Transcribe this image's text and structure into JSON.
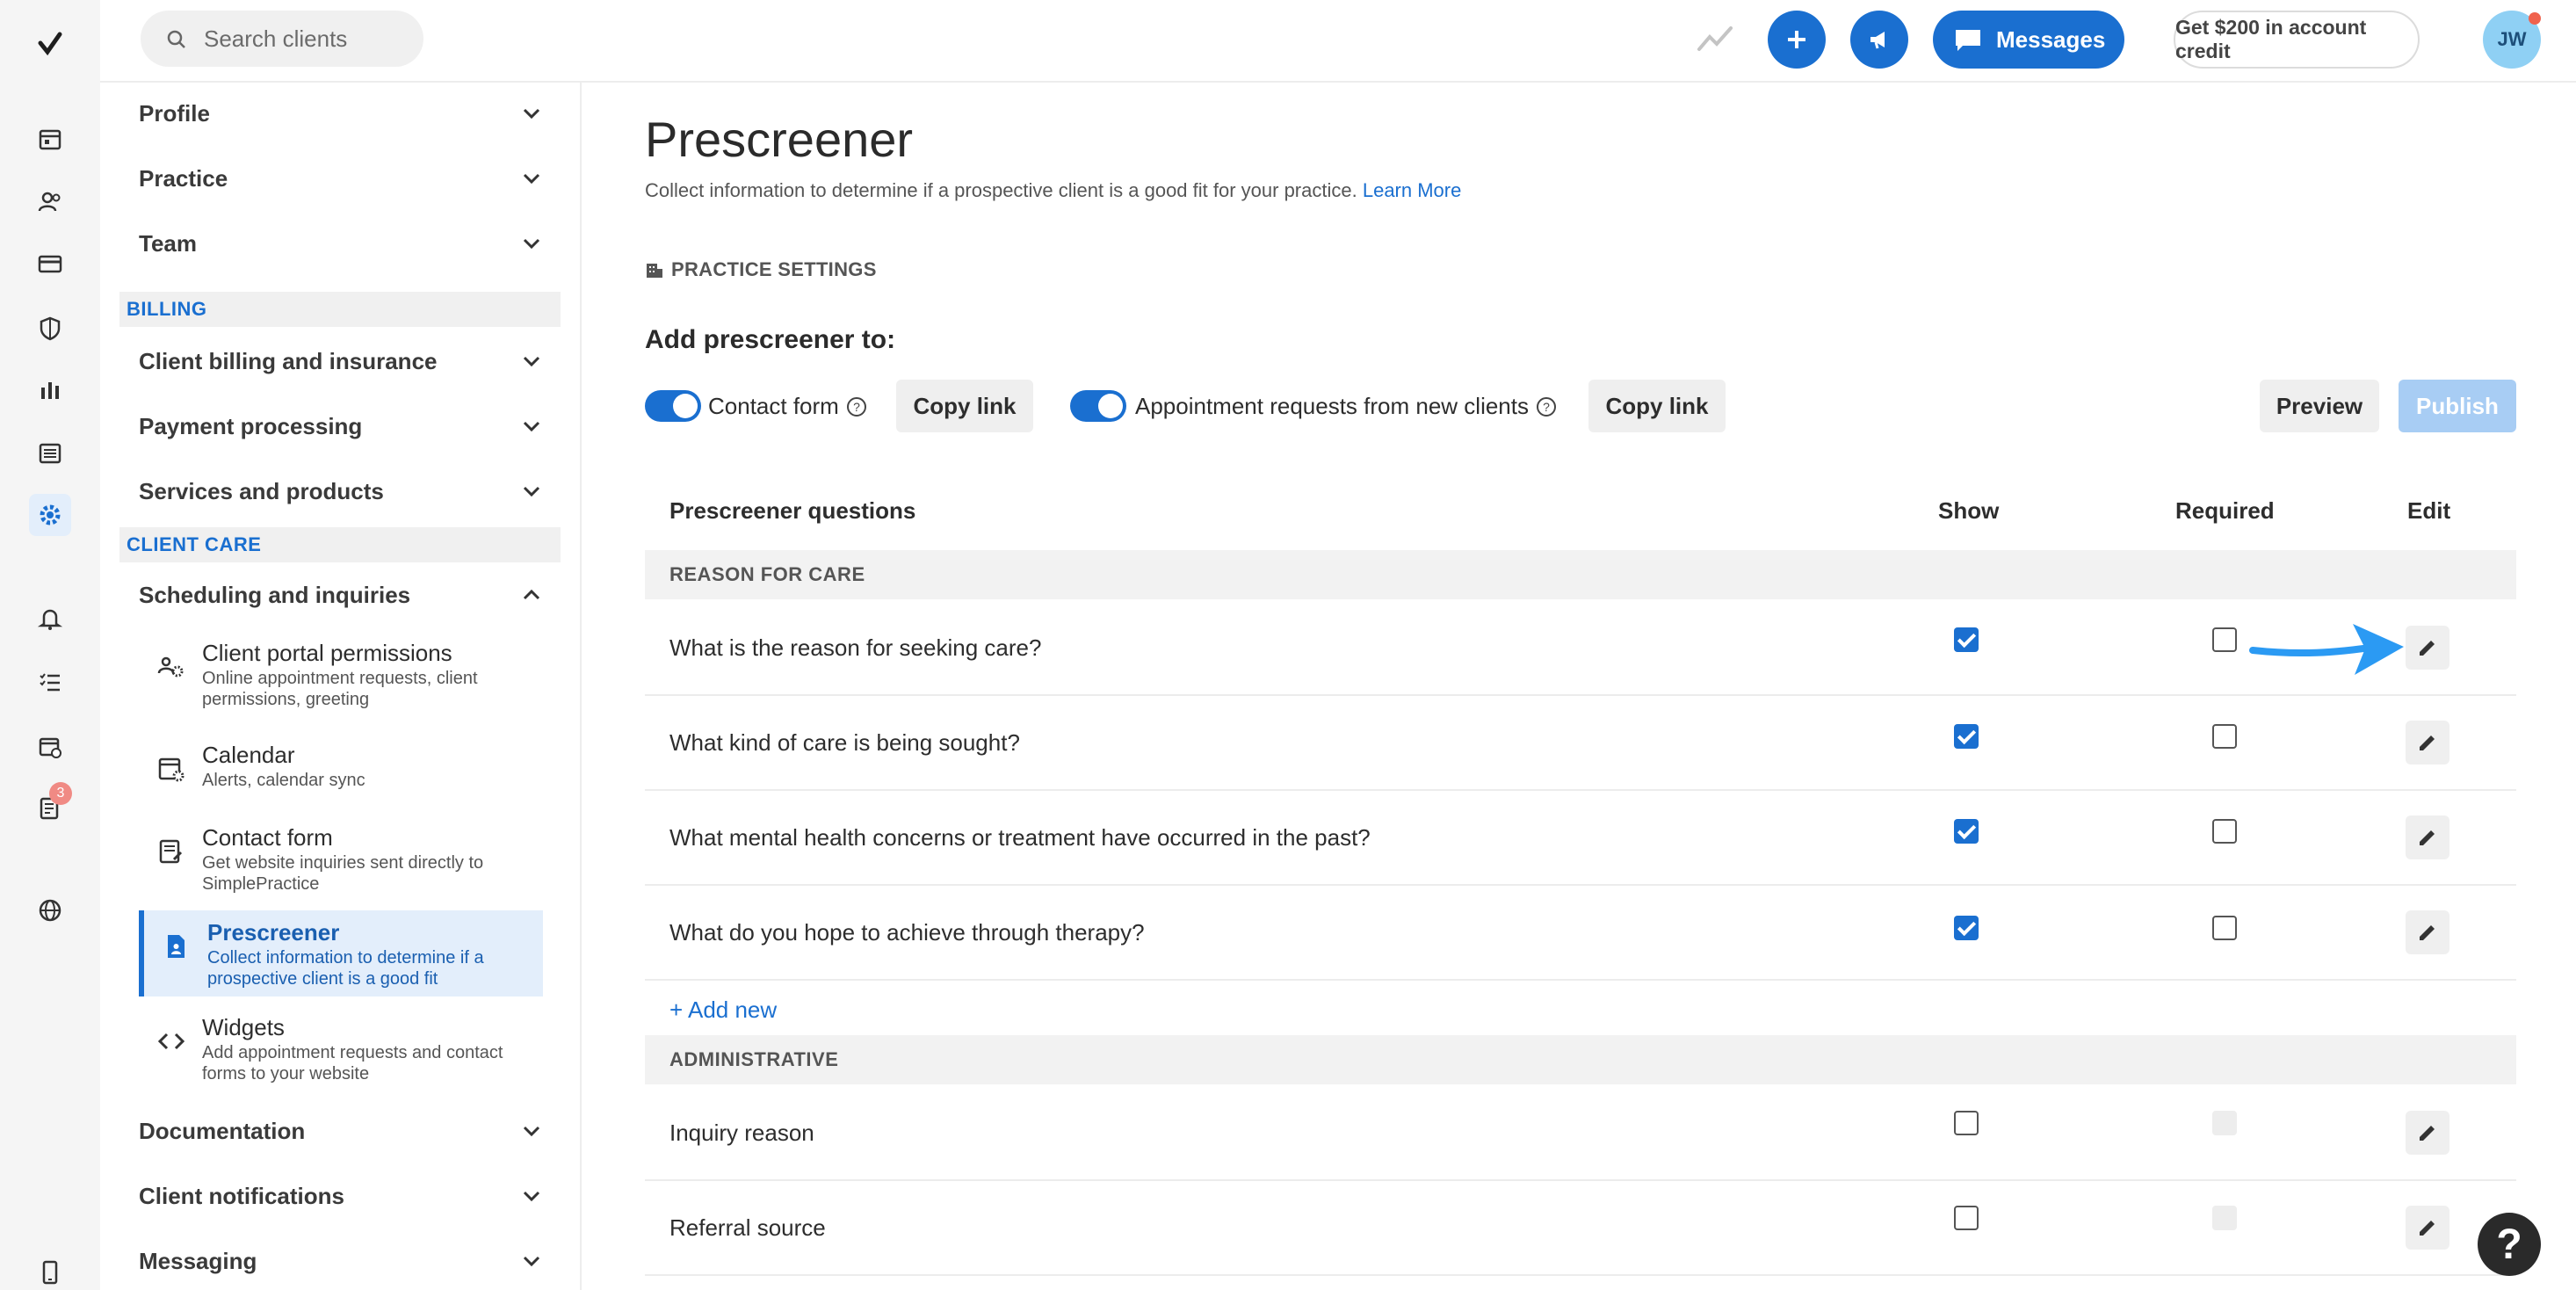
{
  "rail": {
    "badge_count": "3"
  },
  "topbar": {
    "search_placeholder": "Search clients",
    "messages_label": "Messages",
    "credit_label": "Get $200 in account credit",
    "avatar_initials": "JW"
  },
  "sidebar": {
    "top_items": [
      "Profile",
      "Practice",
      "Team"
    ],
    "billing_label": "BILLING",
    "billing_items": [
      "Client billing and insurance",
      "Payment processing",
      "Services and products"
    ],
    "client_care_label": "CLIENT CARE",
    "scheduling_label": "Scheduling and inquiries",
    "sub_items": [
      {
        "title": "Client portal permissions",
        "desc": "Online appointment requests, client permissions, greeting",
        "icon": "people-gear-icon"
      },
      {
        "title": "Calendar",
        "desc": "Alerts, calendar sync",
        "icon": "calendar-gear-icon"
      },
      {
        "title": "Contact form",
        "desc": "Get website inquiries sent directly to SimplePractice",
        "icon": "form-icon"
      },
      {
        "title": "Prescreener",
        "desc": "Collect information to determine if a prospective client is a good fit",
        "icon": "document-person-icon"
      },
      {
        "title": "Widgets",
        "desc": "Add appointment requests and contact forms to your website",
        "icon": "code-icon"
      }
    ],
    "bottom_items": [
      "Documentation",
      "Client notifications",
      "Messaging"
    ]
  },
  "main": {
    "title": "Prescreener",
    "description": "Collect information to determine if a prospective client is a good fit for your practice.",
    "learn_more": "Learn More",
    "practice_settings": "PRACTICE SETTINGS",
    "add_to_label": "Add prescreener to:",
    "contact_form_label": "Contact form",
    "appointment_label": "Appointment requests from new clients",
    "copy_link": "Copy link",
    "preview": "Preview",
    "publish": "Publish",
    "table": {
      "col_question": "Prescreener questions",
      "col_show": "Show",
      "col_required": "Required",
      "col_edit": "Edit",
      "group1": "REASON FOR CARE",
      "group1_rows": [
        {
          "q": "What is the reason for seeking care?",
          "show": true,
          "required": false
        },
        {
          "q": "What kind of care is being sought?",
          "show": true,
          "required": false
        },
        {
          "q": "What mental health concerns or treatment have occurred in the past?",
          "show": true,
          "required": false
        },
        {
          "q": "What do you hope to achieve through therapy?",
          "show": true,
          "required": false
        }
      ],
      "add_new": "+ Add new",
      "group2": "ADMINISTRATIVE",
      "group2_rows": [
        {
          "q": "Inquiry reason",
          "show": false,
          "required": "disabled"
        },
        {
          "q": "Referral source",
          "show": false,
          "required": "disabled"
        }
      ]
    },
    "help_label": "?"
  }
}
